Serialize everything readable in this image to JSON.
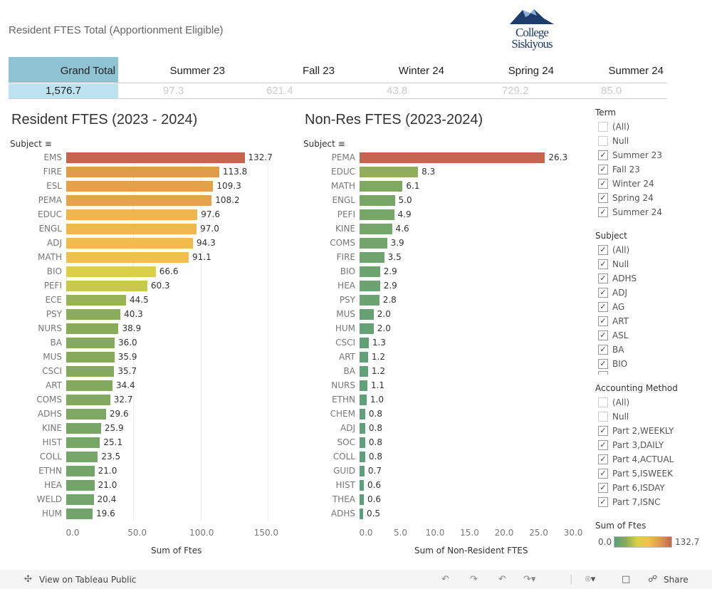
{
  "header": {
    "title": "Resident FTES Total (Apportionment Eligible)",
    "logo_text": [
      "College",
      "Siskiyous"
    ]
  },
  "summary": {
    "grand_total_label": "Grand Total",
    "grand_total_value": "1,576.7",
    "terms": [
      {
        "label": "Summer 23",
        "value": "97.3"
      },
      {
        "label": "Fall 23",
        "value": "621.4"
      },
      {
        "label": "Winter 24",
        "value": "43.8"
      },
      {
        "label": "Spring 24",
        "value": "729.2"
      },
      {
        "label": "Summer 24",
        "value": "85.0"
      }
    ]
  },
  "palette": [
    "#5a9e7e",
    "#8aab5a",
    "#dbd04a",
    "#f2be4e",
    "#e0994c",
    "#c4664f"
  ],
  "chart_data": [
    {
      "type": "bar",
      "orientation": "horizontal",
      "title": "Resident FTES (2023 - 2024)",
      "ylabel": "Subject",
      "xlabel": "Sum of Ftes",
      "xlim": [
        0,
        150
      ],
      "ticks": [
        "0.0",
        "50.0",
        "100.0",
        "150.0"
      ],
      "tick_values": [
        0,
        50,
        100,
        150
      ],
      "grid": true,
      "categories": [
        "EMS",
        "FIRE",
        "ESL",
        "PEMA",
        "EDUC",
        "ENGL",
        "ADJ",
        "MATH",
        "BIO",
        "PEFI",
        "ECE",
        "PSY",
        "NURS",
        "BA",
        "MUS",
        "CSCI",
        "ART",
        "COMS",
        "ADHS",
        "KINE",
        "HIST",
        "COLL",
        "ETHN",
        "HEA",
        "WELD",
        "HUM"
      ],
      "values": [
        132.7,
        113.8,
        109.3,
        108.2,
        97.6,
        97.0,
        94.3,
        91.1,
        66.6,
        60.3,
        44.5,
        40.3,
        38.9,
        36.0,
        35.9,
        35.7,
        34.4,
        32.7,
        29.6,
        25.9,
        25.1,
        23.5,
        21.0,
        21.0,
        20.4,
        19.6
      ]
    },
    {
      "type": "bar",
      "orientation": "horizontal",
      "title": "Non-Res FTES (2023-2024)",
      "ylabel": "Subject",
      "xlabel": "Sum of Non-Resident FTES",
      "xlim": [
        0,
        30
      ],
      "ticks": [
        "0.0",
        "5.0",
        "10.0",
        "15.0",
        "20.0",
        "25.0",
        "30.0"
      ],
      "tick_values": [
        0,
        5,
        10,
        15,
        20,
        25,
        30
      ],
      "grid": false,
      "categories": [
        "PEMA",
        "EDUC",
        "MATH",
        "ENGL",
        "PEFI",
        "KINE",
        "COMS",
        "FIRE",
        "BIO",
        "HEA",
        "PSY",
        "MUS",
        "HUM",
        "CSCI",
        "ART",
        "BA",
        "NURS",
        "ETHN",
        "CHEM",
        "ADJ",
        "SOC",
        "COLL",
        "GUID",
        "HIST",
        "THEA",
        "ADHS"
      ],
      "values": [
        26.3,
        8.3,
        6.1,
        5.0,
        4.9,
        4.6,
        3.9,
        3.5,
        2.9,
        2.9,
        2.8,
        2.0,
        2.0,
        1.3,
        1.2,
        1.2,
        1.1,
        1.0,
        0.8,
        0.8,
        0.8,
        0.8,
        0.7,
        0.6,
        0.6,
        0.5
      ]
    }
  ],
  "filters": {
    "term": {
      "title": "Term",
      "items": [
        {
          "label": "(All)",
          "checked": false
        },
        {
          "label": "Null",
          "checked": false
        },
        {
          "label": "Summer 23",
          "checked": true
        },
        {
          "label": "Fall 23",
          "checked": true
        },
        {
          "label": "Winter 24",
          "checked": true
        },
        {
          "label": "Spring 24",
          "checked": true
        },
        {
          "label": "Summer 24",
          "checked": true
        }
      ]
    },
    "subject": {
      "title": "Subject",
      "items": [
        {
          "label": "(All)",
          "checked": true
        },
        {
          "label": "Null",
          "checked": true
        },
        {
          "label": "ADHS",
          "checked": true
        },
        {
          "label": "ADJ",
          "checked": true
        },
        {
          "label": "AG",
          "checked": true
        },
        {
          "label": "ART",
          "checked": true
        },
        {
          "label": "ASL",
          "checked": true
        },
        {
          "label": "BA",
          "checked": true
        },
        {
          "label": "BIO",
          "checked": true
        }
      ]
    },
    "method": {
      "title": "Accounting Method",
      "items": [
        {
          "label": "(All)",
          "checked": false
        },
        {
          "label": "Null",
          "checked": false
        },
        {
          "label": "Part 2,WEEKLY",
          "checked": true
        },
        {
          "label": "Part 3,DAILY",
          "checked": true
        },
        {
          "label": "Part 4,ACTUAL",
          "checked": true
        },
        {
          "label": "Part 5,ISWEEK",
          "checked": true
        },
        {
          "label": "Part 6,ISDAY",
          "checked": true
        },
        {
          "label": "Part 7,ISNC",
          "checked": true
        }
      ]
    }
  },
  "legend": {
    "title": "Sum of Ftes",
    "min": "0.0",
    "max": "132.7"
  },
  "toolbar": {
    "view_label": "View on Tableau Public",
    "share_label": "Share"
  }
}
